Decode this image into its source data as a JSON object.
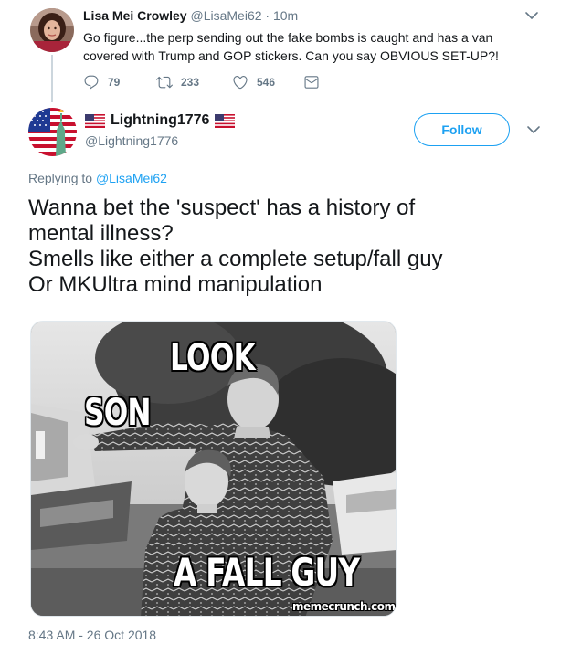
{
  "parent_tweet": {
    "name": "Lisa Mei Crowley",
    "handle": "@LisaMei62",
    "separator": "·",
    "time": "10m",
    "text": "Go figure...the perp sending out the fake bombs is caught and has a van covered with Trump and GOP stickers. Can you say OBVIOUS SET-UP?!",
    "actions": {
      "replies": "79",
      "retweets": "233",
      "likes": "546"
    }
  },
  "tweet": {
    "name": "Lightning1776",
    "handle": "@Lightning1776",
    "follow_label": "Follow",
    "replying_prefix": "Replying to",
    "replying_handle": "@LisaMei62",
    "text_lines": [
      "Wanna bet the 'suspect' has a history of",
      "mental illness?",
      "Smells like either a complete setup/fall guy",
      "Or MKUltra mind manipulation"
    ],
    "meme": {
      "caption_top": "LOOK",
      "caption_left": "SON",
      "caption_bottom": "A FALL GUY",
      "watermark": "memecrunch.com"
    },
    "timestamp": "8:43 AM - 26 Oct 2018"
  },
  "icons": {
    "reply": "reply-icon",
    "retweet": "retweet-icon",
    "like": "heart-icon",
    "message": "envelope-icon",
    "more": "chevron-down-icon",
    "flag": "us-flag-icon"
  },
  "colors": {
    "accent": "#1da1f2",
    "secondary_text": "#657786",
    "primary_text": "#14171a",
    "thread_line": "#ccd6dd"
  }
}
